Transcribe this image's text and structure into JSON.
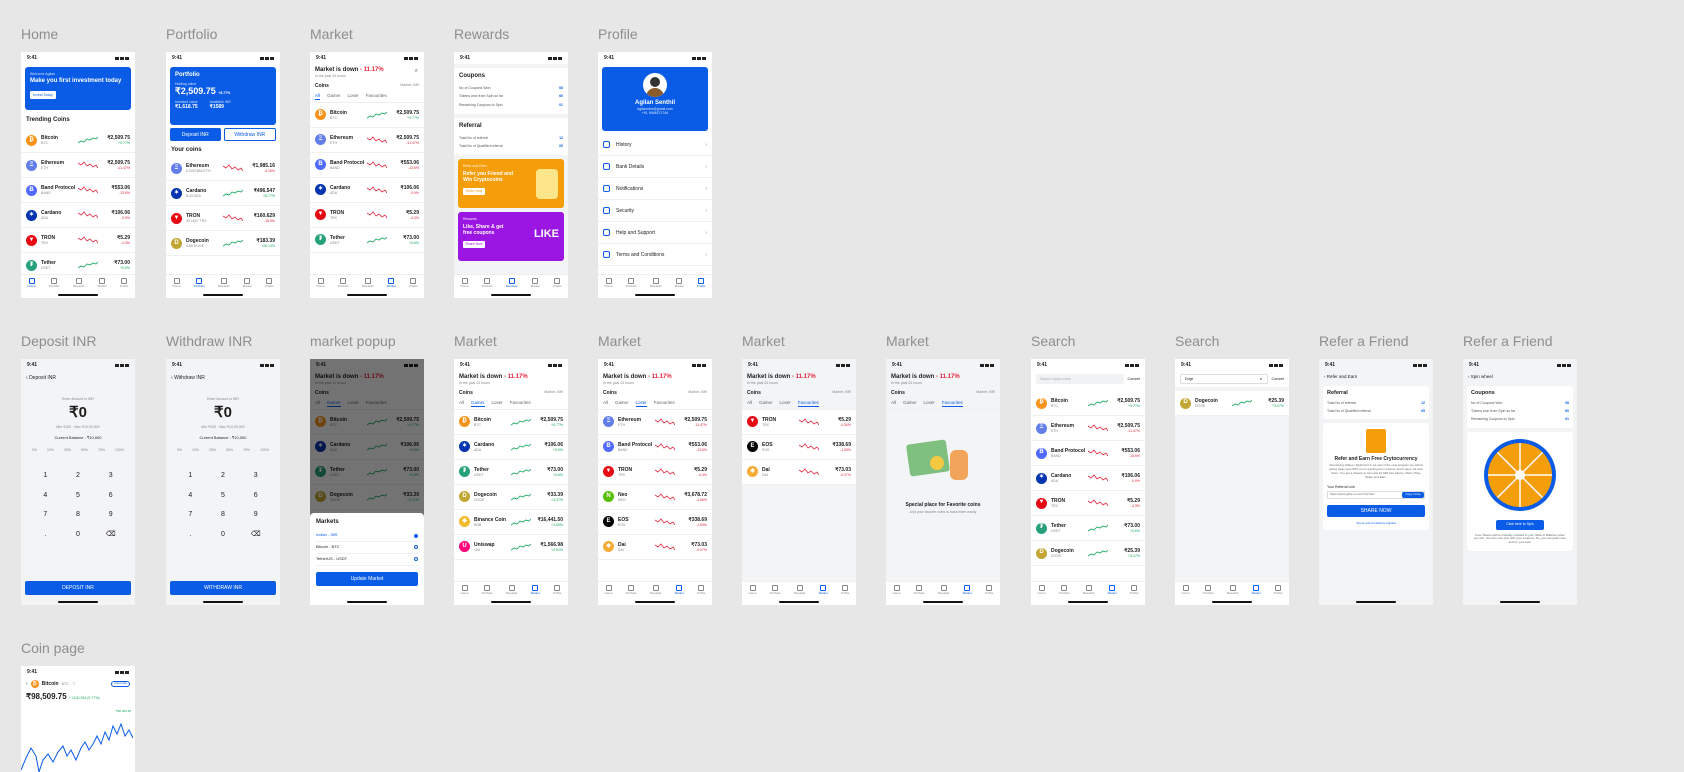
{
  "labels": {
    "home": "Home",
    "portfolio": "Portfolio",
    "market": "Market",
    "rewards": "Rewards",
    "profile": "Profile",
    "deposit": "Deposit INR",
    "withdraw": "Withdraw INR",
    "popup": "market popup",
    "market2": "Market",
    "market3": "Market",
    "market4": "Market",
    "market5": "Market",
    "search1": "Search",
    "search2": "Search",
    "refer1": "Refer a Friend",
    "refer2": "Refer a Friend",
    "coin": "Coin page"
  },
  "status_time": "9:41",
  "nav": [
    "Home",
    "Portfolio",
    "Rewards",
    "Market",
    "Profile"
  ],
  "home": {
    "welcome": "Welcome Agilan",
    "headline": "Make you first investment today",
    "cta": "Invest Today",
    "section": "Trending Coins",
    "coins": [
      {
        "name": "Bitcoin",
        "tick": "BTC",
        "price": "₹2,509.75",
        "chg": "+9.77%",
        "color": "#f7931a",
        "sym": "₿",
        "dir": "up"
      },
      {
        "name": "Ethereum",
        "tick": "ETH",
        "price": "₹2,509.75",
        "chg": "-11.47%",
        "color": "#627eea",
        "sym": "Ξ",
        "dir": "dn"
      },
      {
        "name": "Band Protocol",
        "tick": "BAND",
        "price": "₹553.06",
        "chg": "-13.5%",
        "color": "#516aff",
        "sym": "B",
        "dir": "dn"
      },
      {
        "name": "Cardano",
        "tick": "ADA",
        "price": "₹106.06",
        "chg": "-0.9%",
        "color": "#0033ad",
        "sym": "✶",
        "dir": "dn"
      },
      {
        "name": "TRON",
        "tick": "TRX",
        "price": "₹5.29",
        "chg": "-4.3%",
        "color": "#e50914",
        "sym": "▼",
        "dir": "dn"
      },
      {
        "name": "Tether",
        "tick": "USDT",
        "price": "₹73.00",
        "chg": "+0.6%",
        "color": "#26a17b",
        "sym": "₮",
        "dir": "up"
      }
    ]
  },
  "portfolio": {
    "title": "Portfolio",
    "hold_label": "Holding value",
    "value": "₹2,509.75",
    "chg": "+8.77%",
    "invested_label": "Invested value",
    "invested": "₹1,618.75",
    "avail_label": "Available INR",
    "avail": "₹1589",
    "deposit": "Deposit INR",
    "withdraw": "Withdraw INR",
    "section": "Your coins",
    "coins": [
      {
        "name": "Ethereum",
        "tick": "0.0267664 ETH",
        "price": "₹1,985.16",
        "chg": "-4.19%",
        "color": "#627eea",
        "sym": "Ξ",
        "dir": "dn"
      },
      {
        "name": "Cardano",
        "tick": "8.43 ADA",
        "price": "₹496.547",
        "chg": "+8.77%",
        "color": "#0033ad",
        "sym": "✶",
        "dir": "up"
      },
      {
        "name": "TRON",
        "tick": "32.1807 TRX",
        "price": "₹160.629",
        "chg": "-18.9%",
        "color": "#e50914",
        "sym": "▼",
        "dir": "dn"
      },
      {
        "name": "Dogecoin",
        "tick": "4.89 DOGE",
        "price": "₹183.39",
        "chg": "+26.14%",
        "color": "#c2a633",
        "sym": "D",
        "dir": "up"
      }
    ]
  },
  "market": {
    "title_a": "Market is down",
    "title_b": "- 11.17%",
    "sub": "In the past 24 hours",
    "coins": "Coins",
    "filter": "Market: INR",
    "tabs": [
      "All",
      "Gainer",
      "Loser",
      "Favourites"
    ],
    "list": [
      {
        "name": "Bitcoin",
        "tick": "BTC",
        "price": "₹2,509.75",
        "chg": "+9.77%",
        "color": "#f7931a",
        "sym": "₿",
        "dir": "up"
      },
      {
        "name": "Ethereum",
        "tick": "ETH",
        "price": "₹2,509.75",
        "chg": "-11.47%",
        "color": "#627eea",
        "sym": "Ξ",
        "dir": "dn"
      },
      {
        "name": "Band Protocol",
        "tick": "BAND",
        "price": "₹553.06",
        "chg": "-13.5%",
        "color": "#516aff",
        "sym": "B",
        "dir": "dn"
      },
      {
        "name": "Cardano",
        "tick": "ADA",
        "price": "₹106.06",
        "chg": "-0.9%",
        "color": "#0033ad",
        "sym": "✶",
        "dir": "dn"
      },
      {
        "name": "TRON",
        "tick": "TRX",
        "price": "₹5.29",
        "chg": "-4.3%",
        "color": "#e50914",
        "sym": "▼",
        "dir": "dn"
      },
      {
        "name": "Tether",
        "tick": "USDT",
        "price": "₹73.00",
        "chg": "+0.6%",
        "color": "#26a17b",
        "sym": "₮",
        "dir": "up"
      }
    ]
  },
  "rewards": {
    "coupons": "Coupons",
    "c1": "No of Coupons Won",
    "c1v": "08",
    "c2": "Tokens won from Spin so far",
    "c2v": "60",
    "c3": "Remaining Coupons to Spin",
    "c3v": "01",
    "referral": "Referral",
    "r1": "Total No of referral",
    "r1v": "12",
    "r2": "Total No of Qualified referral",
    "r2v": "05",
    "banner1_tag": "Refer and Earn",
    "banner1": "Refer you Friend and Win Cryptocoins",
    "banner1_btn": "Refer Now",
    "banner2_tag": "Rewards",
    "banner2": "Like, Share & get free coupons",
    "banner2_btn": "Share Now"
  },
  "profile": {
    "name": "Agilan Senthil",
    "email": "agilanmhs@gmail.com",
    "phone": "+91 9944871746",
    "items": [
      "History",
      "Bank Details",
      "Notifications",
      "Security",
      "Help and Support",
      "Terms and Conditions"
    ]
  },
  "deposit": {
    "back": "Deposit INR",
    "hint": "Enter Amount in INR",
    "amount": "₹0",
    "limits": "Min ₹100 · Max ₹10,00,000",
    "balance": "Current Balance : ₹10,000",
    "pcts": [
      "0%",
      "10%",
      "25%",
      "50%",
      "75%",
      "100%"
    ],
    "keys": [
      "1",
      "2",
      "3",
      "4",
      "5",
      "6",
      "7",
      "8",
      "9",
      ".",
      "0",
      "⌫"
    ],
    "btn": "DEPOSIT INR"
  },
  "withdraw": {
    "back": "Withdraw INR",
    "btn": "WITHDRAW INR"
  },
  "popup": {
    "title": "Markets",
    "opts": [
      "Indian - INR",
      "Bitcoin - BTC",
      "TetherUS - USDT"
    ],
    "btn": "Update Market"
  },
  "gainer": [
    {
      "name": "Bitcoin",
      "tick": "BTC",
      "price": "₹2,509.75",
      "chg": "+9.77%",
      "color": "#f7931a",
      "sym": "₿"
    },
    {
      "name": "Cardano",
      "tick": "ADA",
      "price": "₹106.06",
      "chg": "+0.9%",
      "color": "#0033ad",
      "sym": "✶"
    },
    {
      "name": "Tether",
      "tick": "USDT",
      "price": "₹73.00",
      "chg": "+0.6%",
      "color": "#26a17b",
      "sym": "₮"
    },
    {
      "name": "Dogecoin",
      "tick": "DOGE",
      "price": "₹33.39",
      "chg": "+3.37%",
      "color": "#c2a633",
      "sym": "D"
    },
    {
      "name": "Binance Coin",
      "tick": "BNB",
      "price": "₹16,441.50",
      "chg": "+1.09%",
      "color": "#f3ba2f",
      "sym": "◆"
    },
    {
      "name": "Uniswap",
      "tick": "UNI",
      "price": "₹1,566.98",
      "chg": "+4.92%",
      "color": "#ff007a",
      "sym": "U"
    }
  ],
  "loser": [
    {
      "name": "Ethereum",
      "tick": "ETH",
      "price": "₹2,509.75",
      "chg": "-11.47%",
      "color": "#627eea",
      "sym": "Ξ"
    },
    {
      "name": "Band Protocol",
      "tick": "BAND",
      "price": "₹553.06",
      "chg": "-13.5%",
      "color": "#516aff",
      "sym": "B"
    },
    {
      "name": "TRON",
      "tick": "TRX",
      "price": "₹5.29",
      "chg": "-4.3%",
      "color": "#e50914",
      "sym": "▼"
    },
    {
      "name": "Neo",
      "tick": "NEO",
      "price": "₹3,678.72",
      "chg": "-2.66%",
      "color": "#58bf00",
      "sym": "N"
    },
    {
      "name": "EOS",
      "tick": "EOS",
      "price": "₹338.69",
      "chg": "-1.93%",
      "color": "#000000",
      "sym": "E"
    },
    {
      "name": "Dai",
      "tick": "DAI",
      "price": "₹73.03",
      "chg": "-0.07%",
      "color": "#f5ac37",
      "sym": "◈"
    }
  ],
  "favs": [
    {
      "name": "TRON",
      "tick": "TRX",
      "price": "₹5.29",
      "chg": "-4.30%",
      "color": "#e50914",
      "sym": "▼"
    },
    {
      "name": "EOS",
      "tick": "EOS",
      "price": "₹338.69",
      "chg": "-1.93%",
      "color": "#000000",
      "sym": "E"
    },
    {
      "name": "Dai",
      "tick": "DAI",
      "price": "₹73.03",
      "chg": "-0.07%",
      "color": "#f5ac37",
      "sym": "◈"
    }
  ],
  "empty": {
    "title": "Special place for Favorite coins",
    "sub": "Add your favorite coins to track them easily"
  },
  "search": {
    "placeholder": "Search crypto coins",
    "cancel": "Cancel",
    "query": "Doge",
    "result": {
      "name": "Dogecoin",
      "tick": "DOGE",
      "price": "₹25.39",
      "chg": "+3.47%",
      "color": "#c2a633",
      "sym": "D"
    },
    "list": [
      {
        "name": "Bitcoin",
        "tick": "BTC",
        "price": "₹2,509.75",
        "chg": "+9.77%",
        "color": "#f7931a",
        "sym": "₿",
        "dir": "up"
      },
      {
        "name": "Ethereum",
        "tick": "ETH",
        "price": "₹2,509.75",
        "chg": "-11.47%",
        "color": "#627eea",
        "sym": "Ξ",
        "dir": "dn"
      },
      {
        "name": "Band Protocol",
        "tick": "BAND",
        "price": "₹553.06",
        "chg": "-13.5%",
        "color": "#516aff",
        "sym": "B",
        "dir": "dn"
      },
      {
        "name": "Cardano",
        "tick": "ADA",
        "price": "₹106.06",
        "chg": "-0.9%",
        "color": "#0033ad",
        "sym": "✶",
        "dir": "dn"
      },
      {
        "name": "TRON",
        "tick": "TRX",
        "price": "₹5.29",
        "chg": "-4.3%",
        "color": "#e50914",
        "sym": "▼",
        "dir": "dn"
      },
      {
        "name": "Tether",
        "tick": "USDT",
        "price": "₹73.00",
        "chg": "+0.6%",
        "color": "#26a17b",
        "sym": "₮",
        "dir": "up"
      },
      {
        "name": "Dogecoin",
        "tick": "DOGE",
        "price": "₹25.39",
        "chg": "+3.47%",
        "color": "#c2a633",
        "sym": "D",
        "dir": "up"
      }
    ]
  },
  "refer": {
    "back": "Refer and Earn",
    "head": "Referral",
    "r1": "Total No of referral",
    "r1v": "12",
    "r2": "Total No of Qualified referral",
    "r2v": "05",
    "title": "Refer and Earn Free Crytocurrency",
    "body": "Introducing Glide.io Referral 2.0. As part of the new program we will be giving away upto 50% of our earning from referral. And it does not stop there. You get a chance to win upto 10,000 free tokens. Refer, Play, Share and Earn.",
    "link_label": "Your Referral Link",
    "link": "https://www.glide.io.com/?ref=abc",
    "copy": "Copy Code",
    "share": "SHARE NOW",
    "terms": "Terms and Conditions Applied"
  },
  "spin": {
    "back": "Spin wheel",
    "head": "Coupons",
    "c1": "No of Coupons Won",
    "c1v": "08",
    "c2": "Tokens won from Spin so far",
    "c2v": "60",
    "c3": "Remaining Coupons to Spin",
    "c3v": "01",
    "btn": "Click here to Spin",
    "note": "Free Tokens will be instantly credited to your Glide.io Balance when you win. You can only spin with your coupons. So, you can grab more and try your luck."
  },
  "coinpage": {
    "name": "Bitcoin",
    "tick": "BTC",
    "badge": "Favourite",
    "price": "₹98,509.75",
    "chg": "+ 1100,254 (9.77%)",
    "high": "₹98,256.48"
  }
}
